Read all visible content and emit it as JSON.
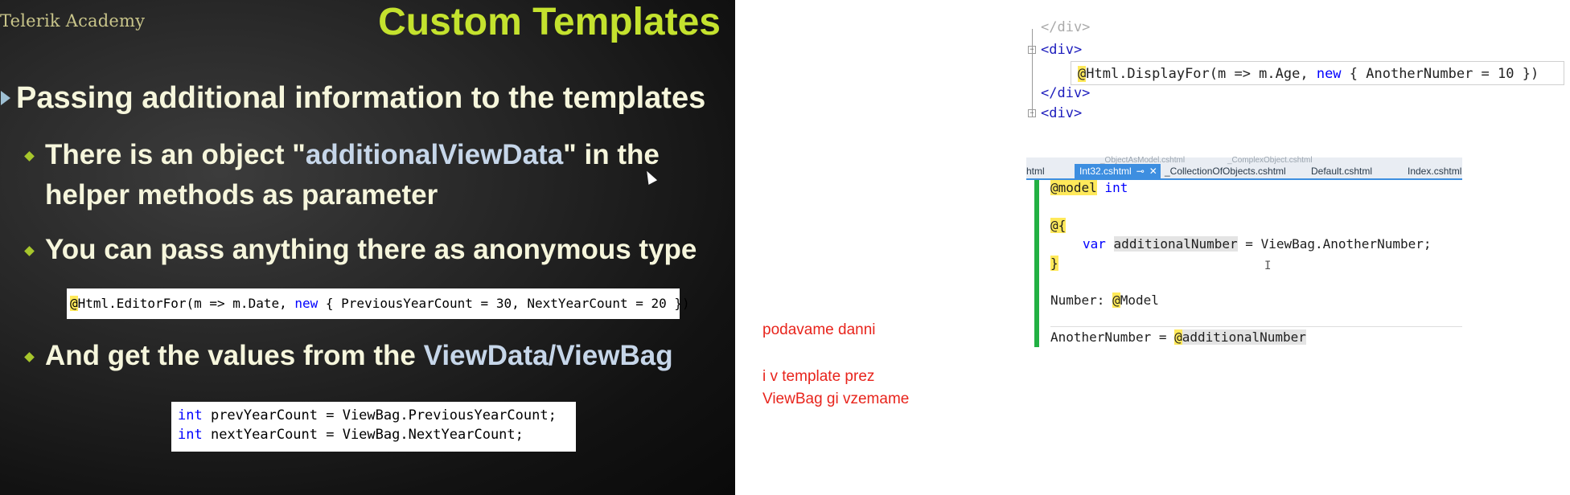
{
  "slide": {
    "logo": "Telerik Academy",
    "title": "Custom Templates",
    "bullet_main": "Passing additional information to the templates",
    "sub1_pre": "There is an object \"",
    "sub1_hl": "additionalViewData",
    "sub1_post": "\" in the helper methods as parameter",
    "sub2": "You can pass anything there as anonymous type",
    "code1": {
      "at": "@",
      "part1": "Html.EditorFor(m => m.Date, ",
      "kw": "new",
      "part2": " { PreviousYearCount = 30, NextYearCount = 20 })"
    },
    "sub3_pre": "And get the values from the ",
    "sub3_hl": "ViewData/ViewBag",
    "code2": {
      "line1_kw": "int",
      "line1_rest": " prevYearCount = ViewBag.PreviousYearCount;",
      "line2_kw": "int",
      "line2_rest": " nextYearCount = ViewBag.NextYearCount;"
    }
  },
  "notes": {
    "line1": "podavame danni",
    "line2": "i v template prez",
    "line3": "ViewBag gi vzemame"
  },
  "snippet": {
    "line0": "</div>",
    "line1": "<div>",
    "line2_at": "@",
    "line2_a": "Html.DisplayFor(m => m.Age, ",
    "line2_kw": "new",
    "line2_b": " { AnotherNumber = 10 })",
    "line3": "</div>",
    "line4": "<div>"
  },
  "editor": {
    "tabs": {
      "prev": "html",
      "active": "Int32.cshtml",
      "pin": "⊸",
      "close": "✕",
      "t3": "_CollectionOfObjects.cshtml",
      "t4": "Default.cshtml",
      "t5": "Index.cshtml"
    },
    "ghost_tabs": [
      "_ObjectAsModel.cshtml",
      "_ComplexObject.cshtml"
    ],
    "line1_at": "@model",
    "line1_kw": "int",
    "line2": "@{",
    "line3_kw": "var",
    "line3_var": "additionalNumber",
    "line3_rest": " = ViewBag.AnotherNumber;",
    "line4": "}",
    "line5_pre": "Number: ",
    "line5_at": "@",
    "line5_post": "Model",
    "line6_pre": "AnotherNumber = ",
    "line6_at": "@",
    "line6_post": "additionalNumber"
  },
  "colors": {
    "title": "#c4e22e",
    "bullet_text": "#f6f6dc",
    "highlight_text": "#c6d6e9",
    "note_red": "#e8241c",
    "keyword_blue": "#0000ff",
    "tab_active": "#3d8ee0",
    "change_bar": "#22b043"
  }
}
